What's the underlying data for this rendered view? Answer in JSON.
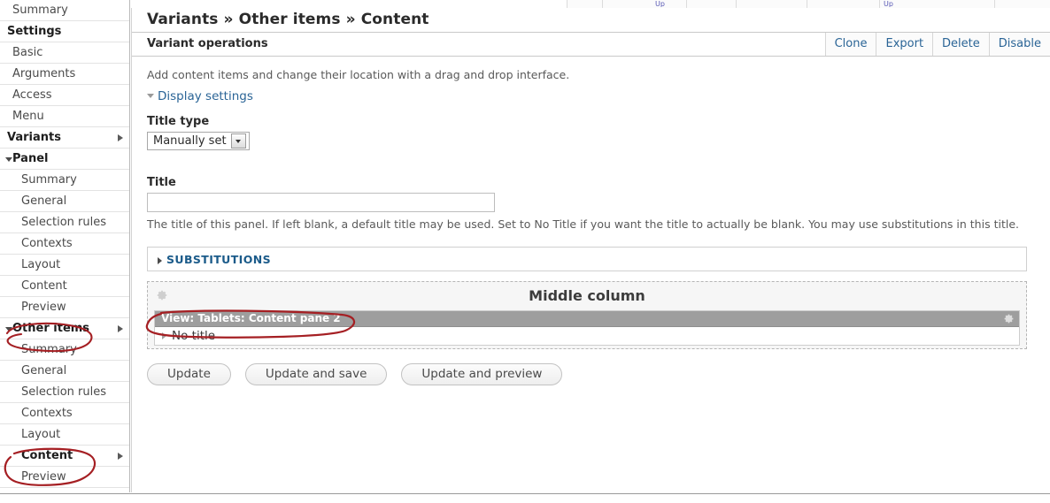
{
  "top_strip": {
    "note": "cut-off table header row",
    "cells": [
      "",
      "",
      "",
      "",
      "",
      "",
      ""
    ]
  },
  "sidebar": {
    "items": [
      {
        "label": "Summary",
        "level": 1,
        "bold": false,
        "arrow": "none"
      },
      {
        "label": "Settings",
        "level": 0,
        "bold": true,
        "arrow": "none"
      },
      {
        "label": "Basic",
        "level": 1,
        "bold": false,
        "arrow": "none"
      },
      {
        "label": "Arguments",
        "level": 1,
        "bold": false,
        "arrow": "none"
      },
      {
        "label": "Access",
        "level": 1,
        "bold": false,
        "arrow": "none"
      },
      {
        "label": "Menu",
        "level": 1,
        "bold": false,
        "arrow": "none"
      },
      {
        "label": "Variants",
        "level": 0,
        "bold": true,
        "arrow": "right"
      },
      {
        "label": "Panel",
        "level": 1,
        "bold": true,
        "arrow": "down"
      },
      {
        "label": "Summary",
        "level": 2,
        "bold": false,
        "arrow": "none"
      },
      {
        "label": "General",
        "level": 2,
        "bold": false,
        "arrow": "none"
      },
      {
        "label": "Selection rules",
        "level": 2,
        "bold": false,
        "arrow": "none"
      },
      {
        "label": "Contexts",
        "level": 2,
        "bold": false,
        "arrow": "none"
      },
      {
        "label": "Layout",
        "level": 2,
        "bold": false,
        "arrow": "none"
      },
      {
        "label": "Content",
        "level": 2,
        "bold": false,
        "arrow": "none"
      },
      {
        "label": "Preview",
        "level": 2,
        "bold": false,
        "arrow": "none"
      },
      {
        "label": "Other items",
        "level": 1,
        "bold": true,
        "arrow": "down-right"
      },
      {
        "label": "Summary",
        "level": 2,
        "bold": false,
        "arrow": "none"
      },
      {
        "label": "General",
        "level": 2,
        "bold": false,
        "arrow": "none"
      },
      {
        "label": "Selection rules",
        "level": 2,
        "bold": false,
        "arrow": "none"
      },
      {
        "label": "Contexts",
        "level": 2,
        "bold": false,
        "arrow": "none"
      },
      {
        "label": "Layout",
        "level": 2,
        "bold": false,
        "arrow": "none"
      },
      {
        "label": "Content",
        "level": 2,
        "bold": true,
        "arrow": "right"
      },
      {
        "label": "Preview",
        "level": 2,
        "bold": false,
        "arrow": "none"
      }
    ]
  },
  "page": {
    "title": "Variants » Other items » Content"
  },
  "operations": {
    "title": "Variant operations",
    "links": [
      "Clone",
      "Export",
      "Delete",
      "Disable"
    ]
  },
  "content": {
    "help": "Add content items and change their location with a drag and drop interface.",
    "display_settings_label": "Display settings",
    "title_type_label": "Title type",
    "title_type_value": "Manually set",
    "title_label": "Title",
    "title_value": "",
    "title_placeholder": "",
    "title_description": "The title of this panel. If left blank, a default title may be used. Set to No Title if you want the title to actually be blank. You may use substitutions in this title.",
    "substitutions_label": "SUBSTITUTIONS",
    "region_title": "Middle column",
    "pane_title": "View: Tablets: Content pane 2",
    "pane_body_label": "No title",
    "buttons": [
      "Update",
      "Update and save",
      "Update and preview"
    ]
  },
  "annotations": {
    "color": "#a51f23",
    "marks": [
      {
        "name": "circle-other-items",
        "target": "Other items"
      },
      {
        "name": "circle-content",
        "target": "Content"
      },
      {
        "name": "circle-pane-title",
        "target": "View: Tablets: Content pane 2"
      }
    ]
  },
  "colors": {
    "link": "#2a6496",
    "heading": "#2b2b2b",
    "pane_header_bg": "#9e9e9e",
    "region_bg": "#f6f6f6",
    "annotation_red": "#a51f23"
  }
}
